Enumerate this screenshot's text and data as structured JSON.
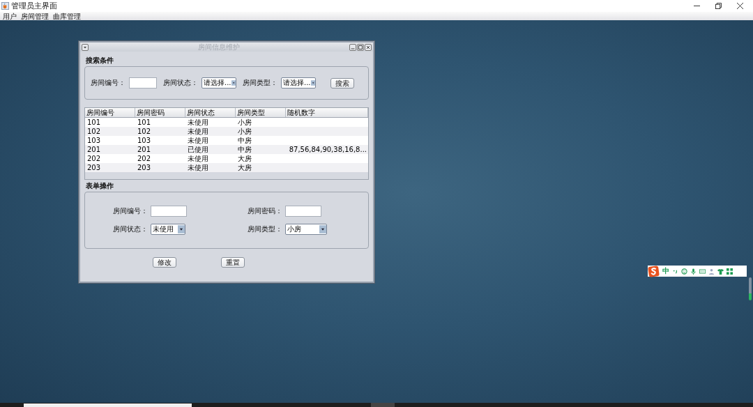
{
  "window": {
    "title": "管理员主界面"
  },
  "menu": [
    {
      "label": "用户"
    },
    {
      "label": "房间管理"
    },
    {
      "label": "曲库管理"
    }
  ],
  "frame": {
    "title": "房间信息维护",
    "search": {
      "title": "搜索条件",
      "fields": [
        {
          "kind": "text",
          "label": "房间编号："
        },
        {
          "kind": "select",
          "label": "房间状态：",
          "value": "请选择..."
        },
        {
          "kind": "select",
          "label": "房间类型：",
          "value": "请选择..."
        }
      ],
      "button": "搜索"
    },
    "table": {
      "columns": [
        "房间编号",
        "房间密码",
        "房间状态",
        "房间类型",
        "随机数字"
      ],
      "rows": [
        {
          "cells": [
            "101",
            "101",
            "未使用",
            "小房"
          ]
        },
        {
          "cells": [
            "102",
            "102",
            "未使用",
            "小房"
          ]
        },
        {
          "cells": [
            "103",
            "103",
            "未使用",
            "中房"
          ]
        },
        {
          "cells": [
            "201",
            "201",
            "已使用",
            "中房",
            "87,56,84,90,38,16,8..."
          ]
        },
        {
          "cells": [
            "202",
            "202",
            "未使用",
            "大房"
          ]
        },
        {
          "cells": [
            "203",
            "203",
            "未使用",
            "大房"
          ]
        }
      ]
    },
    "form": {
      "title": "表单操作",
      "fields": [
        {
          "kind": "text",
          "label": "房间编号："
        },
        {
          "kind": "text",
          "label": "房间密码："
        },
        {
          "kind": "select",
          "label": "房间状态：",
          "value": "未使用"
        },
        {
          "kind": "select",
          "label": "房间类型：",
          "value": "小房"
        }
      ],
      "buttons": [
        "修改",
        "重置"
      ]
    }
  },
  "ime": {
    "mode": "中"
  }
}
